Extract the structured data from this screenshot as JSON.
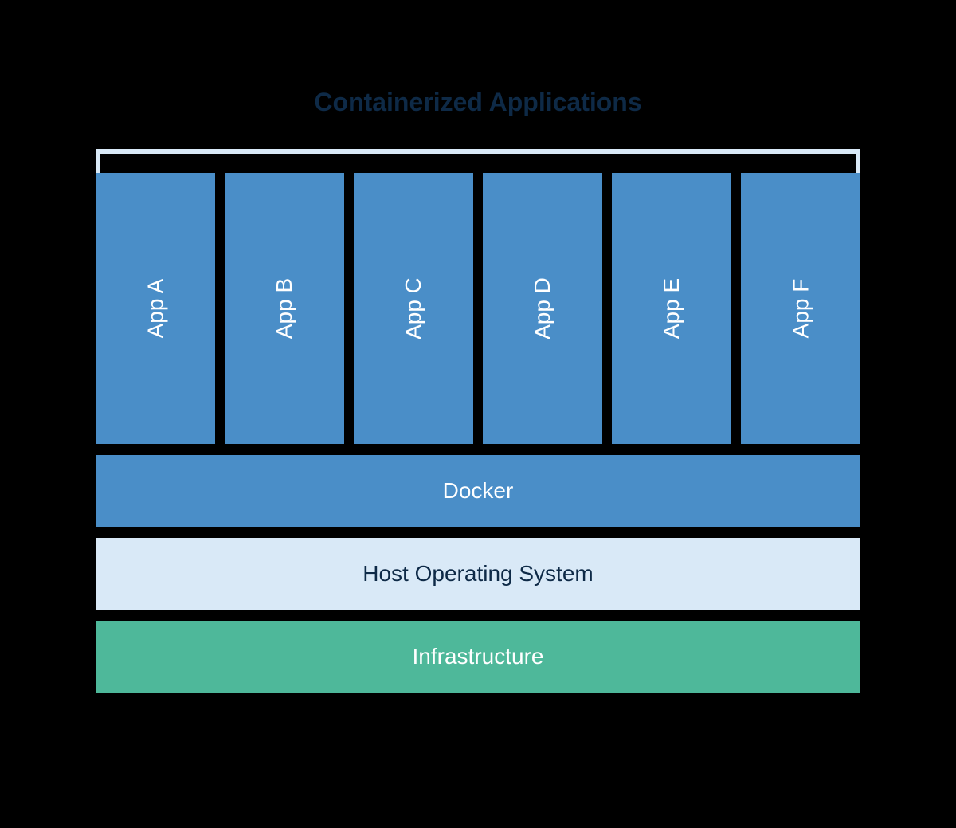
{
  "title": "Containerized Applications",
  "apps": {
    "0": "App A",
    "1": "App B",
    "2": "App C",
    "3": "App D",
    "4": "App E",
    "5": "App F"
  },
  "layers": {
    "docker": "Docker",
    "host": "Host Operating System",
    "infrastructure": "Infrastructure"
  },
  "colors": {
    "app_box": "#4a8ec8",
    "docker": "#4a8ec8",
    "host": "#d9e9f7",
    "infrastructure": "#4eb89a",
    "title_text": "#0e2a47",
    "background": "#000000"
  }
}
